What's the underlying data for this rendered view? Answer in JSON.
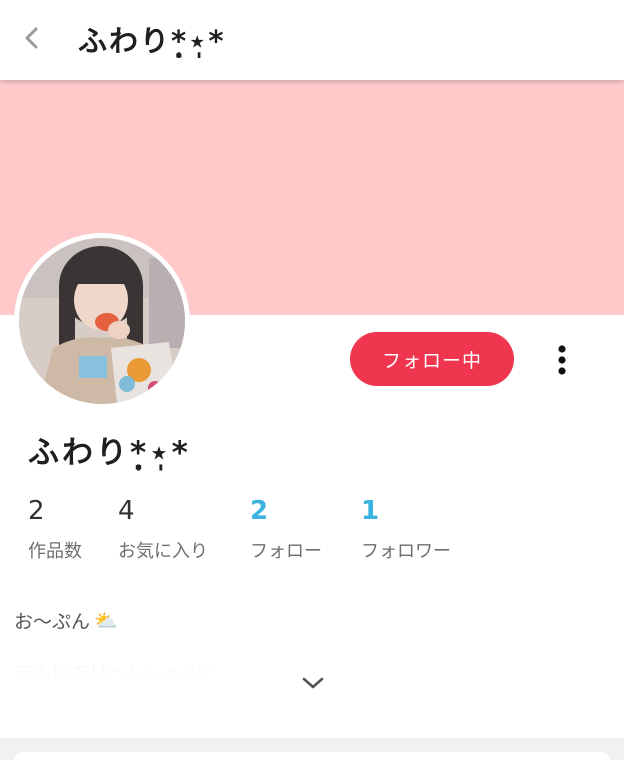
{
  "header": {
    "title": "ふわり*̣̩⋆̩*",
    "back_icon": "chevron-left-icon"
  },
  "profile": {
    "name": "ふわり*̣̩⋆̩*",
    "follow_button_label": "フォロー中",
    "more_icon": "more-vertical-icon"
  },
  "stats": [
    {
      "value": "2",
      "label": "作品数"
    },
    {
      "value": "4",
      "label": "お気に入り"
    },
    {
      "value": "2",
      "label": "フォロー"
    },
    {
      "value": "1",
      "label": "フォロワー"
    }
  ],
  "bio": {
    "line1": "お～ぷん",
    "line1_emoji": "⛅",
    "line2": "こんにちは～(｡•ᴗ•｡)♡",
    "expand_icon": "chevron-down-icon"
  },
  "colors": {
    "cover": "#ffc9c9",
    "follow_button": "#f0354f",
    "accent_blue": "#3bb3e0"
  }
}
